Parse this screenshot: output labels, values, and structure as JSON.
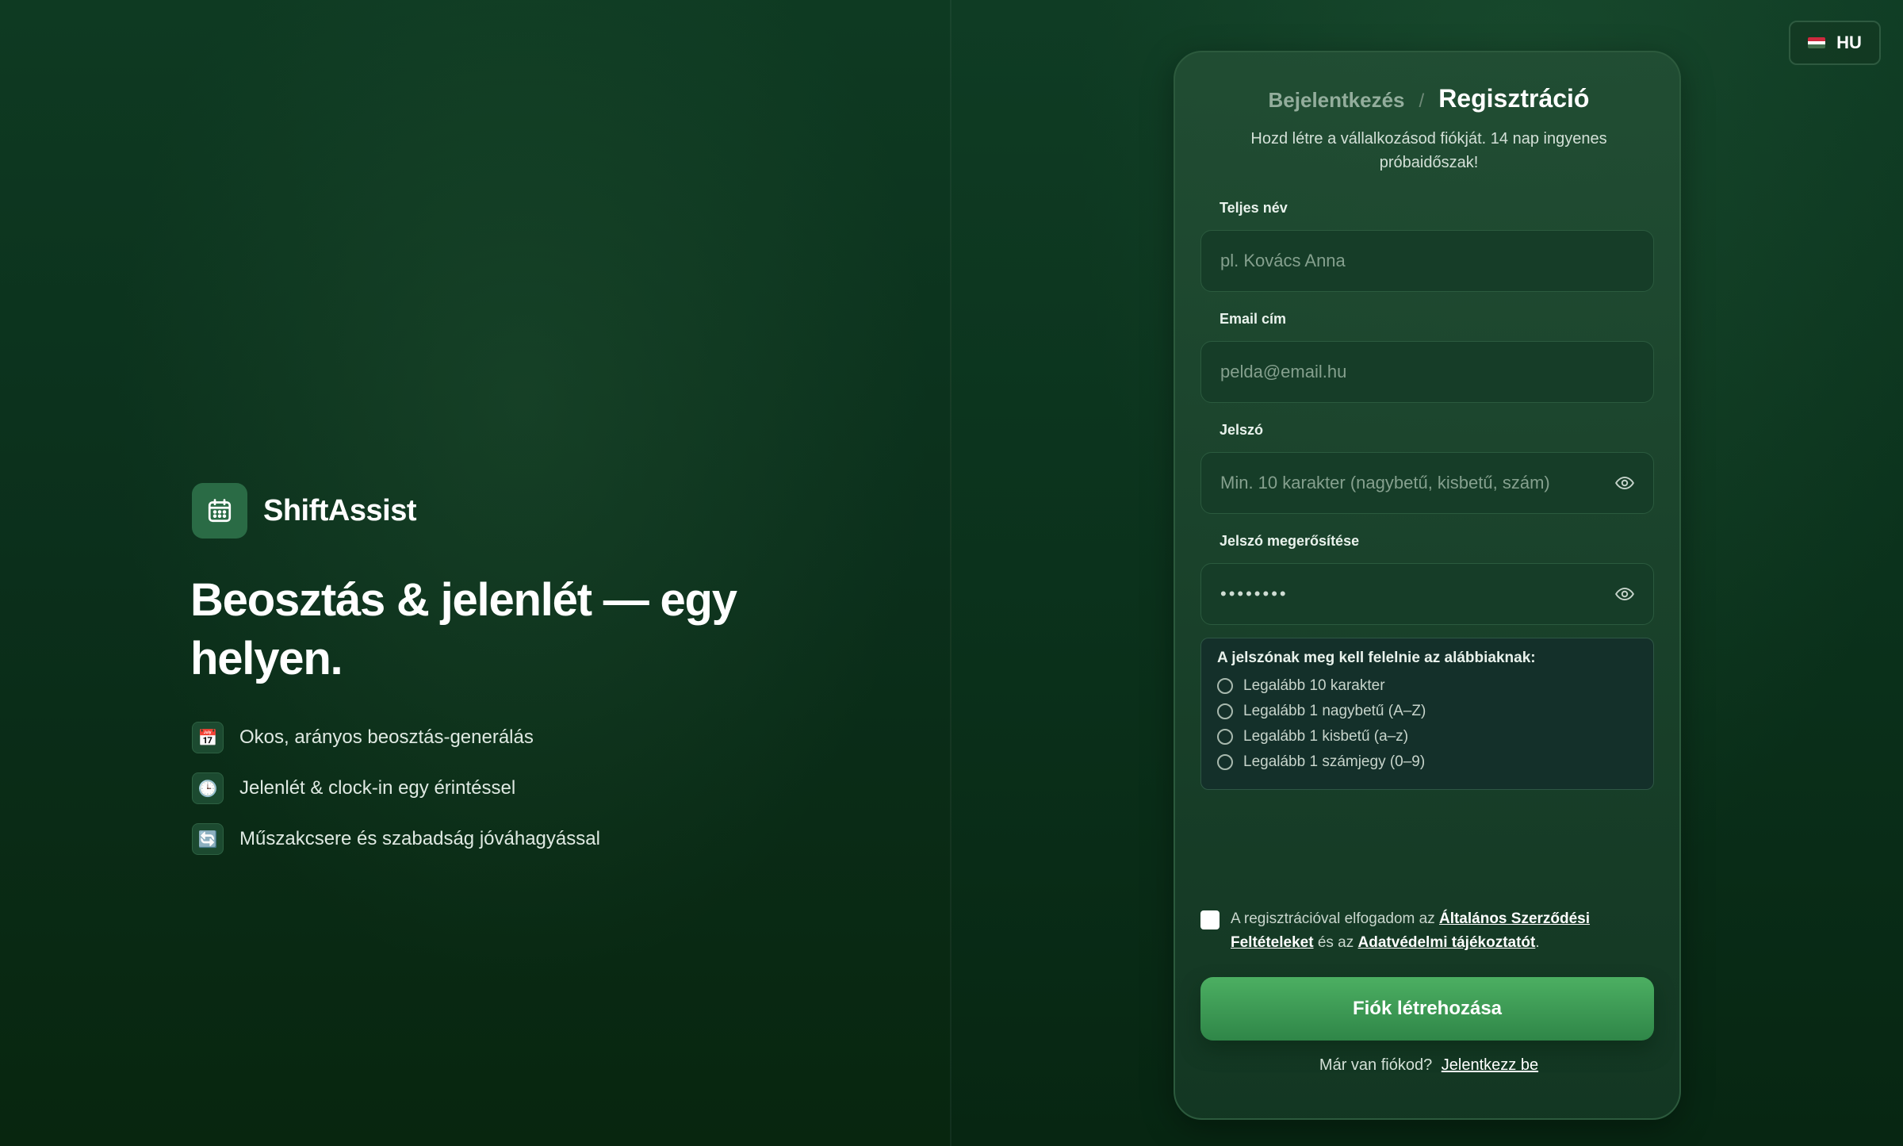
{
  "brand": {
    "name": "ShiftAssist",
    "headline": "Beosztás & jelenlét — egy helyen."
  },
  "features": [
    {
      "icon": "calendar-icon",
      "glyph": "📅",
      "text": "Okos, arányos beosztás-generálás"
    },
    {
      "icon": "clock-icon",
      "glyph": "🕒",
      "text": "Jelenlét & clock-in egy érintéssel"
    },
    {
      "icon": "swap-icon",
      "glyph": "🔄",
      "text": "Műszakcsere és szabadság jóváhagyással"
    }
  ],
  "lang": {
    "label": "HU",
    "flag_colors": [
      "#cd2a3e",
      "#ffffff",
      "#436f4d"
    ]
  },
  "auth": {
    "tab_login": "Bejelentkezés",
    "tab_separator": "/",
    "tab_register": "Regisztráció",
    "subtitle": "Hozd létre a vállalkozásod fiókját. 14 nap ingyenes próbaidőszak!"
  },
  "form": {
    "name_label": "Teljes név",
    "name_placeholder": "pl. Kovács Anna",
    "email_label": "Email cím",
    "email_placeholder": "pelda@email.hu",
    "password_label": "Jelszó",
    "password_placeholder": "Min. 10 karakter (nagybetű, kisbetű, szám)",
    "confirm_label": "Jelszó megerősítése",
    "confirm_value": "••••••••"
  },
  "rules": {
    "title": "A jelszónak meg kell felelnie az alábbiaknak:",
    "items": [
      "Legalább 10 karakter",
      "Legalább 1 nagybetű (A–Z)",
      "Legalább 1 kisbetű (a–z)",
      "Legalább 1 számjegy (0–9)"
    ]
  },
  "terms": {
    "prefix": "A regisztrációval elfogadom az",
    "terms_link": "Általános Szerződési Feltételeket",
    "middle": "és az",
    "privacy_link": "Adatvédelmi tájékoztatót",
    "suffix": "."
  },
  "submit_label": "Fiók létrehozása",
  "signin": {
    "prompt": "Már van fiókod?",
    "link": "Jelentkezz be"
  },
  "colors": {
    "accent": "#3f9c58",
    "background": "#0b3019"
  }
}
